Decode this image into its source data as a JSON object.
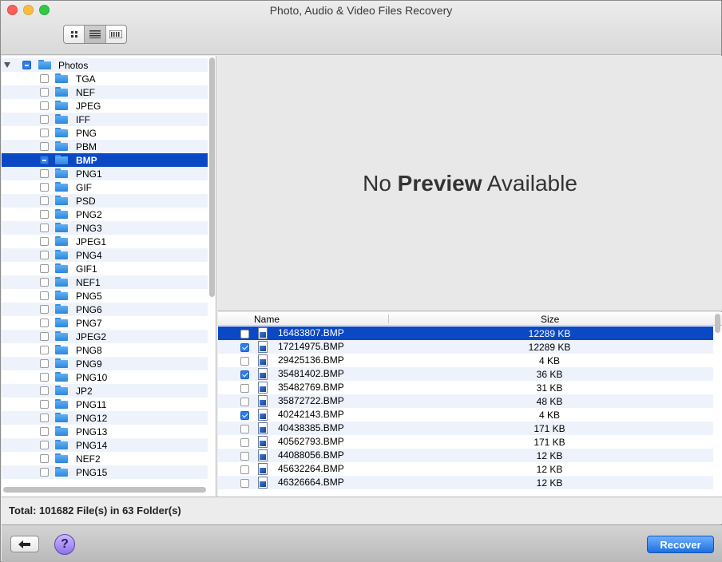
{
  "window": {
    "title": "Photo, Audio & Video Files Recovery"
  },
  "toolbar": {
    "views": [
      "icon-view",
      "list-view",
      "column-view"
    ],
    "active_view": "list-view"
  },
  "tree": {
    "root": {
      "label": "Photos",
      "state": "mixed",
      "expanded": true
    },
    "items": [
      {
        "label": "TGA",
        "state": "unchecked"
      },
      {
        "label": "NEF",
        "state": "unchecked"
      },
      {
        "label": "JPEG",
        "state": "unchecked"
      },
      {
        "label": "IFF",
        "state": "unchecked"
      },
      {
        "label": "PNG",
        "state": "unchecked"
      },
      {
        "label": "PBM",
        "state": "unchecked"
      },
      {
        "label": "BMP",
        "state": "mixed",
        "selected": true
      },
      {
        "label": "PNG1",
        "state": "unchecked"
      },
      {
        "label": "GIF",
        "state": "unchecked"
      },
      {
        "label": "PSD",
        "state": "unchecked"
      },
      {
        "label": "PNG2",
        "state": "unchecked"
      },
      {
        "label": "PNG3",
        "state": "unchecked"
      },
      {
        "label": "JPEG1",
        "state": "unchecked"
      },
      {
        "label": "PNG4",
        "state": "unchecked"
      },
      {
        "label": "GIF1",
        "state": "unchecked"
      },
      {
        "label": "NEF1",
        "state": "unchecked"
      },
      {
        "label": "PNG5",
        "state": "unchecked"
      },
      {
        "label": "PNG6",
        "state": "unchecked"
      },
      {
        "label": "PNG7",
        "state": "unchecked"
      },
      {
        "label": "JPEG2",
        "state": "unchecked"
      },
      {
        "label": "PNG8",
        "state": "unchecked"
      },
      {
        "label": "PNG9",
        "state": "unchecked"
      },
      {
        "label": "PNG10",
        "state": "unchecked"
      },
      {
        "label": "JP2",
        "state": "unchecked"
      },
      {
        "label": "PNG11",
        "state": "unchecked"
      },
      {
        "label": "PNG12",
        "state": "unchecked"
      },
      {
        "label": "PNG13",
        "state": "unchecked"
      },
      {
        "label": "PNG14",
        "state": "unchecked"
      },
      {
        "label": "NEF2",
        "state": "unchecked"
      },
      {
        "label": "PNG15",
        "state": "unchecked"
      }
    ]
  },
  "preview": {
    "text_before": "No ",
    "text_bold": "Preview",
    "text_after": " Available"
  },
  "filelist": {
    "columns": {
      "name": "Name",
      "size": "Size"
    },
    "rows": [
      {
        "name": "16483807.BMP",
        "size": "12289 KB",
        "checked": false,
        "selected": true
      },
      {
        "name": "17214975.BMP",
        "size": "12289 KB",
        "checked": true
      },
      {
        "name": "29425136.BMP",
        "size": "4 KB",
        "checked": false
      },
      {
        "name": "35481402.BMP",
        "size": "36 KB",
        "checked": true
      },
      {
        "name": "35482769.BMP",
        "size": "31 KB",
        "checked": false
      },
      {
        "name": "35872722.BMP",
        "size": "48 KB",
        "checked": false
      },
      {
        "name": "40242143.BMP",
        "size": "4 KB",
        "checked": true
      },
      {
        "name": "40438385.BMP",
        "size": "171 KB",
        "checked": false
      },
      {
        "name": "40562793.BMP",
        "size": "171 KB",
        "checked": false
      },
      {
        "name": "44088056.BMP",
        "size": "12 KB",
        "checked": false
      },
      {
        "name": "45632264.BMP",
        "size": "12 KB",
        "checked": false
      },
      {
        "name": "46326664.BMP",
        "size": "12 KB",
        "checked": false
      }
    ]
  },
  "status": {
    "total": "Total: 101682 File(s) in 63 Folder(s)"
  },
  "bottom": {
    "help_label": "?",
    "recover_label": "Recover"
  },
  "colors": {
    "selection": "#0a48c4",
    "accent": "#2d7cf0",
    "recover": "#1d6fe0"
  }
}
